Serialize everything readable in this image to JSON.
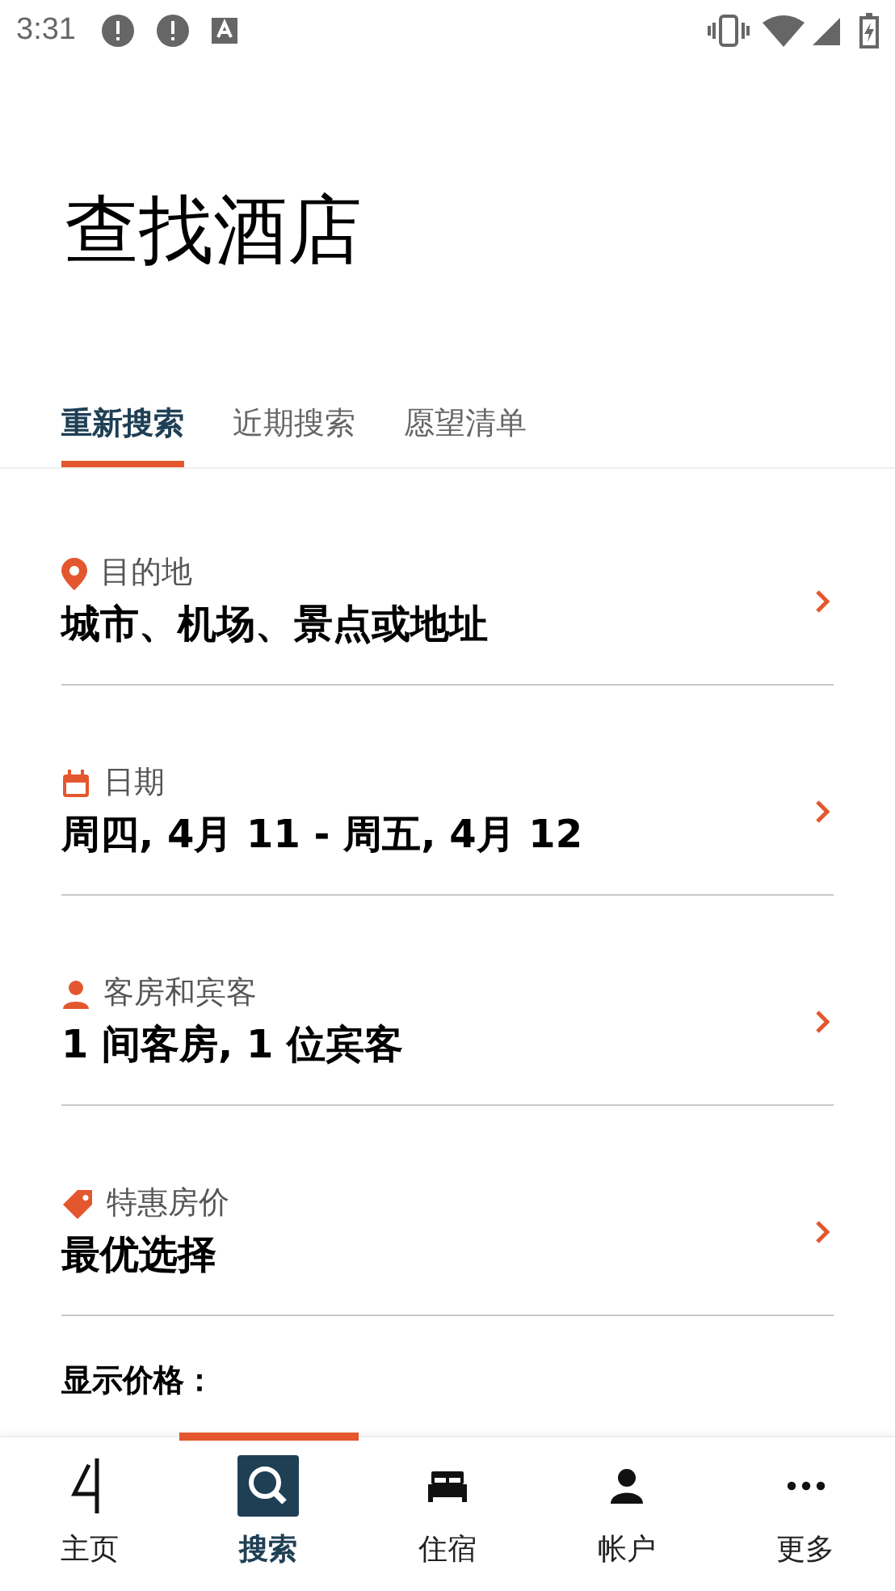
{
  "status_bar": {
    "time": "3:31"
  },
  "title": "查找酒店",
  "tabs": [
    {
      "label": "重新搜索",
      "selected": true
    },
    {
      "label": "近期搜索",
      "selected": false
    },
    {
      "label": "愿望清单",
      "selected": false
    }
  ],
  "fields": [
    {
      "kind": "pin",
      "label": "目的地",
      "value": "城市、机场、景点或地址"
    },
    {
      "kind": "calendar",
      "label": "日期",
      "value": "周四, 4月 11 - 周五, 4月 12"
    },
    {
      "kind": "person",
      "label": "客房和宾客",
      "value": "1 间客房, 1 位宾客"
    },
    {
      "kind": "tag",
      "label": "特惠房价",
      "value": "最优选择"
    }
  ],
  "price_heading": "显示价格：",
  "nav": [
    {
      "kind": "logo",
      "label": "主页",
      "selected": false
    },
    {
      "kind": "search",
      "label": "搜索",
      "selected": true
    },
    {
      "kind": "bed",
      "label": "住宿",
      "selected": false
    },
    {
      "kind": "person",
      "label": "帐户",
      "selected": false
    },
    {
      "kind": "more",
      "label": "更多",
      "selected": false
    }
  ]
}
